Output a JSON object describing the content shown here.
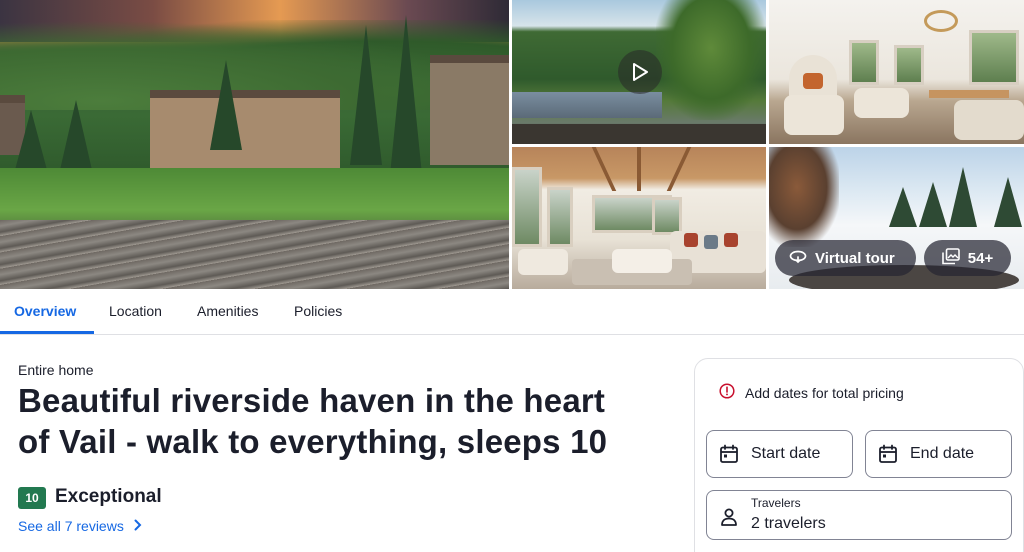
{
  "gallery": {
    "virtual_tour_label": "Virtual tour",
    "photo_count_label": "54+"
  },
  "tabs": [
    {
      "label": "Overview",
      "active": true
    },
    {
      "label": "Location",
      "active": false
    },
    {
      "label": "Amenities",
      "active": false
    },
    {
      "label": "Policies",
      "active": false
    }
  ],
  "listing": {
    "type": "Entire home",
    "title_line1": "Beautiful riverside haven in the heart",
    "title_line2": "of Vail - walk to everything, sleeps 10",
    "rating_score": "10",
    "rating_label": "Exceptional",
    "reviews_link": "See all 7 reviews"
  },
  "booking": {
    "notice": "Add dates for total pricing",
    "start_date_placeholder": "Start date",
    "end_date_placeholder": "End date",
    "travelers_label": "Travelers",
    "travelers_value": "2 travelers"
  },
  "colors": {
    "accent": "#1668e3",
    "rating_badge": "#227950",
    "notice_icon": "#c8102e"
  }
}
